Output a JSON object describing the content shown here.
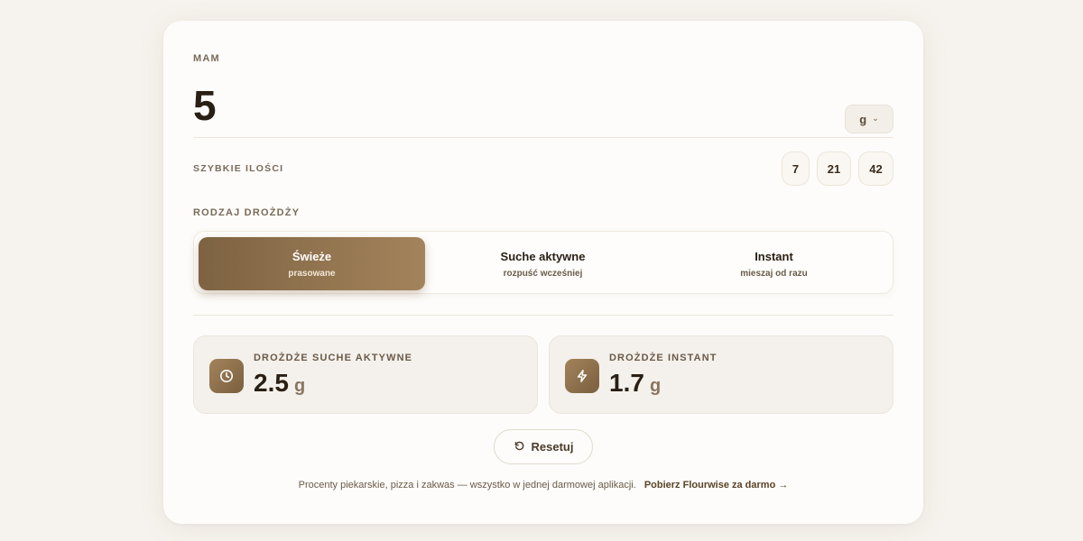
{
  "amount": {
    "label": "MAM",
    "value": "5",
    "unit": "g",
    "unit_icon": "chevron-down-icon"
  },
  "quick": {
    "label": "SZYBKIE ILOŚCI",
    "options": [
      "7",
      "21",
      "42"
    ]
  },
  "yeast_type": {
    "label": "RODZAJ DROŻDŻY",
    "selected": 0,
    "options": [
      {
        "title": "Świeże",
        "subtitle": "prasowane"
      },
      {
        "title": "Suche aktywne",
        "subtitle": "rozpuść wcześniej"
      },
      {
        "title": "Instant",
        "subtitle": "mieszaj od razu"
      }
    ]
  },
  "results": [
    {
      "label": "DROŻDŻE SUCHE AKTYWNE",
      "value": "2.5",
      "unit": "g",
      "icon": "clock-icon"
    },
    {
      "label": "DROŻDŻE INSTANT",
      "value": "1.7",
      "unit": "g",
      "icon": "lightning-icon"
    }
  ],
  "reset": {
    "label": "Resetuj",
    "icon": "reset-icon"
  },
  "footer": {
    "text": "Procenty piekarskie, pizza i zakwas — wszystko w jednej darmowej aplikacji.",
    "cta": "Pobierz Flourwise za darmo →"
  },
  "colors": {
    "accent": "#8b6d48",
    "background": "#f6f3ee",
    "card": "#fdfcfa"
  }
}
